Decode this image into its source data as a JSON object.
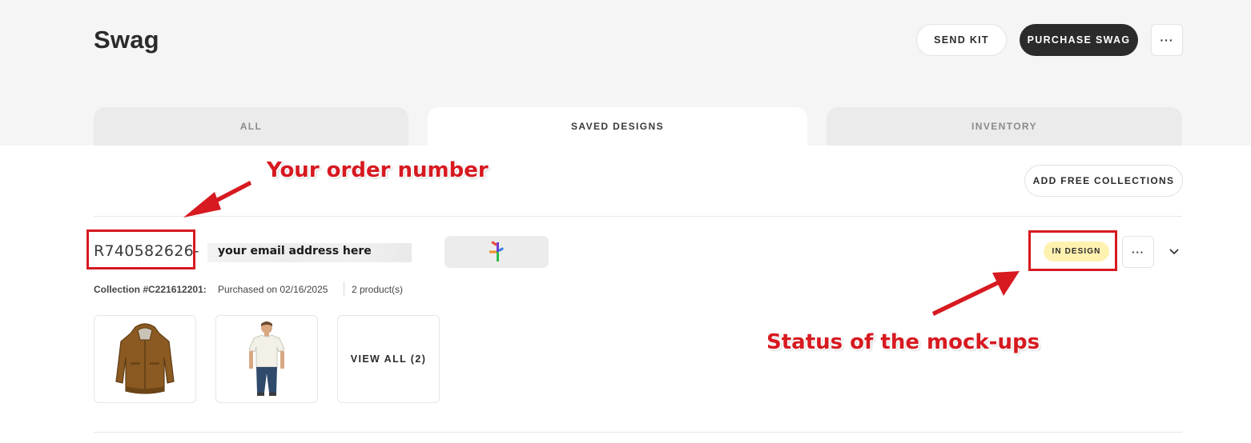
{
  "header": {
    "title": "Swag",
    "send_kit_label": "SEND KIT",
    "purchase_label": "PURCHASE SWAG",
    "more_label": "···"
  },
  "tabs": [
    {
      "label": "ALL",
      "active": false
    },
    {
      "label": "SAVED DESIGNS",
      "active": true
    },
    {
      "label": "INVENTORY",
      "active": false
    }
  ],
  "toolbar": {
    "add_free_label": "ADD FREE COLLECTIONS"
  },
  "order": {
    "number": "R740582626",
    "dash": "-",
    "email": "your email address here",
    "collection": "Collection #C221612201:",
    "purchased": "Purchased on 02/16/2025",
    "products": "2 product(s)",
    "status": "IN DESIGN",
    "more_label": "···",
    "view_all_label": "VIEW ALL (2)"
  },
  "annotations": {
    "order_label": "Your order number",
    "status_label": "Status of the mock-ups"
  },
  "colors": {
    "accent_dark": "#2b2b2b",
    "status_badge": "#fff2b0",
    "annotation_red": "#d71920",
    "header_bg": "#f5f5f5"
  },
  "icons": {
    "more": "ellipsis-icon",
    "expand": "chevron-down-icon",
    "logo": "brand-logo-icon"
  }
}
